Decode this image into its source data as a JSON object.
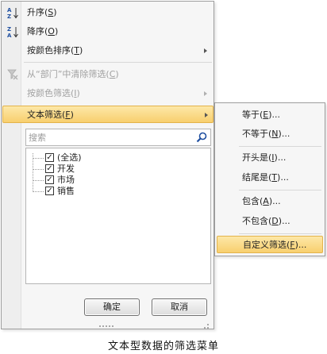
{
  "menu": {
    "items": [
      {
        "label": "升序(S)",
        "icon": "sort-ascending-icon"
      },
      {
        "label": "降序(O)",
        "icon": "sort-descending-icon"
      },
      {
        "label": "按颜色排序(T)",
        "submenu": true
      },
      {
        "label": "从“部门”中清除筛选(C)",
        "icon": "clear-filter-icon",
        "disabled": true
      },
      {
        "label": "按颜色筛选(I)",
        "submenu": true,
        "disabled": true
      },
      {
        "label": "文本筛选(F)",
        "submenu": true,
        "highlighted": true
      }
    ],
    "search": {
      "placeholder": "搜索",
      "icon": "search-icon"
    },
    "list": [
      {
        "label": "(全选)",
        "checked": true
      },
      {
        "label": "开发",
        "checked": true
      },
      {
        "label": "市场",
        "checked": true
      },
      {
        "label": "销售",
        "checked": true
      }
    ],
    "ok_label": "确定",
    "cancel_label": "取消"
  },
  "submenu": {
    "items": [
      {
        "label": "等于(E)..."
      },
      {
        "label": "不等于(N)..."
      },
      {
        "label": "开头是(I)..."
      },
      {
        "label": "结尾是(T)..."
      },
      {
        "label": "包含(A)..."
      },
      {
        "label": "不包含(D)..."
      },
      {
        "label": "自定义筛选(F)...",
        "highlighted": true
      }
    ]
  },
  "caption": "文本型数据的筛选菜单",
  "colors": {
    "highlight_top": "#fde8a8",
    "highlight_bottom": "#f8cf6e",
    "highlight_border": "#e3b34a"
  }
}
